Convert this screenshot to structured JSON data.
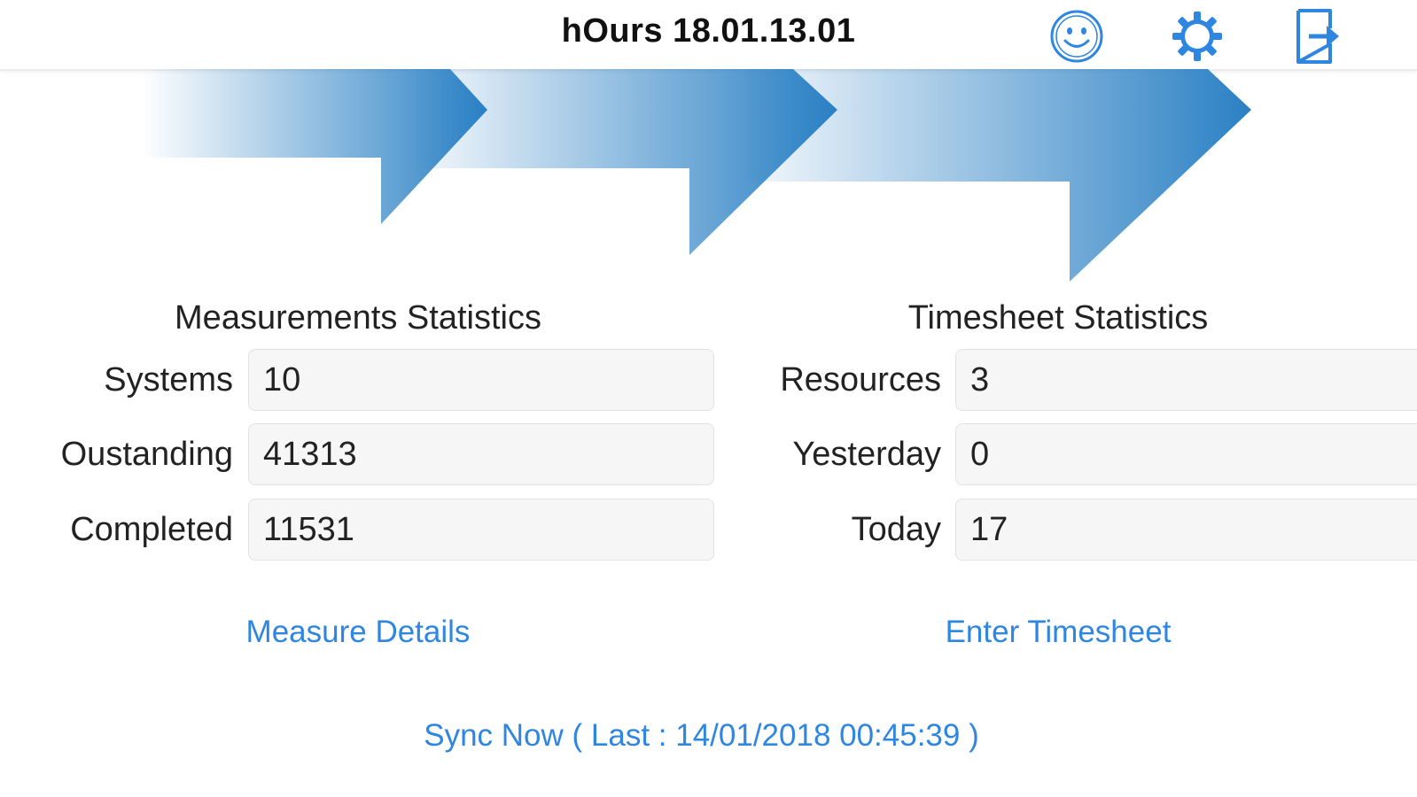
{
  "header": {
    "title": "hOurs 18.01.13.01",
    "icons": [
      "smiley-icon",
      "gear-icon",
      "logout-icon"
    ]
  },
  "colors": {
    "accent": "#2f86e0",
    "arrow": "#2a80c4",
    "field_bg": "#f6f6f6"
  },
  "measurements": {
    "title": "Measurements Statistics",
    "rows": [
      {
        "label": "Systems",
        "value": "10"
      },
      {
        "label": "Oustanding",
        "value": "41313"
      },
      {
        "label": "Completed",
        "value": "11531"
      }
    ],
    "link": "Measure Details"
  },
  "timesheet": {
    "title": "Timesheet Statistics",
    "rows": [
      {
        "label": "Resources",
        "value": "3"
      },
      {
        "label": "Yesterday",
        "value": "0"
      },
      {
        "label": "Today",
        "value": "17"
      }
    ],
    "link": "Enter Timesheet"
  },
  "sync": {
    "label": "Sync Now ( Last : 14/01/2018 00:45:39 )"
  }
}
